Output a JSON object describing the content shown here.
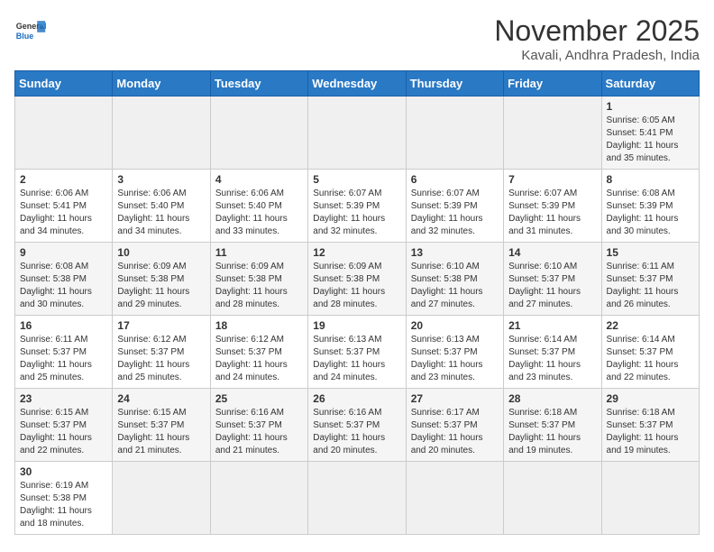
{
  "header": {
    "logo_general": "General",
    "logo_blue": "Blue",
    "month_year": "November 2025",
    "location": "Kavali, Andhra Pradesh, India"
  },
  "days_of_week": [
    "Sunday",
    "Monday",
    "Tuesday",
    "Wednesday",
    "Thursday",
    "Friday",
    "Saturday"
  ],
  "weeks": [
    [
      {
        "day": "",
        "info": ""
      },
      {
        "day": "",
        "info": ""
      },
      {
        "day": "",
        "info": ""
      },
      {
        "day": "",
        "info": ""
      },
      {
        "day": "",
        "info": ""
      },
      {
        "day": "",
        "info": ""
      },
      {
        "day": "1",
        "info": "Sunrise: 6:05 AM\nSunset: 5:41 PM\nDaylight: 11 hours\nand 35 minutes."
      }
    ],
    [
      {
        "day": "2",
        "info": "Sunrise: 6:06 AM\nSunset: 5:41 PM\nDaylight: 11 hours\nand 34 minutes."
      },
      {
        "day": "3",
        "info": "Sunrise: 6:06 AM\nSunset: 5:40 PM\nDaylight: 11 hours\nand 34 minutes."
      },
      {
        "day": "4",
        "info": "Sunrise: 6:06 AM\nSunset: 5:40 PM\nDaylight: 11 hours\nand 33 minutes."
      },
      {
        "day": "5",
        "info": "Sunrise: 6:07 AM\nSunset: 5:39 PM\nDaylight: 11 hours\nand 32 minutes."
      },
      {
        "day": "6",
        "info": "Sunrise: 6:07 AM\nSunset: 5:39 PM\nDaylight: 11 hours\nand 32 minutes."
      },
      {
        "day": "7",
        "info": "Sunrise: 6:07 AM\nSunset: 5:39 PM\nDaylight: 11 hours\nand 31 minutes."
      },
      {
        "day": "8",
        "info": "Sunrise: 6:08 AM\nSunset: 5:39 PM\nDaylight: 11 hours\nand 30 minutes."
      }
    ],
    [
      {
        "day": "9",
        "info": "Sunrise: 6:08 AM\nSunset: 5:38 PM\nDaylight: 11 hours\nand 30 minutes."
      },
      {
        "day": "10",
        "info": "Sunrise: 6:09 AM\nSunset: 5:38 PM\nDaylight: 11 hours\nand 29 minutes."
      },
      {
        "day": "11",
        "info": "Sunrise: 6:09 AM\nSunset: 5:38 PM\nDaylight: 11 hours\nand 28 minutes."
      },
      {
        "day": "12",
        "info": "Sunrise: 6:09 AM\nSunset: 5:38 PM\nDaylight: 11 hours\nand 28 minutes."
      },
      {
        "day": "13",
        "info": "Sunrise: 6:10 AM\nSunset: 5:38 PM\nDaylight: 11 hours\nand 27 minutes."
      },
      {
        "day": "14",
        "info": "Sunrise: 6:10 AM\nSunset: 5:37 PM\nDaylight: 11 hours\nand 27 minutes."
      },
      {
        "day": "15",
        "info": "Sunrise: 6:11 AM\nSunset: 5:37 PM\nDaylight: 11 hours\nand 26 minutes."
      }
    ],
    [
      {
        "day": "16",
        "info": "Sunrise: 6:11 AM\nSunset: 5:37 PM\nDaylight: 11 hours\nand 25 minutes."
      },
      {
        "day": "17",
        "info": "Sunrise: 6:12 AM\nSunset: 5:37 PM\nDaylight: 11 hours\nand 25 minutes."
      },
      {
        "day": "18",
        "info": "Sunrise: 6:12 AM\nSunset: 5:37 PM\nDaylight: 11 hours\nand 24 minutes."
      },
      {
        "day": "19",
        "info": "Sunrise: 6:13 AM\nSunset: 5:37 PM\nDaylight: 11 hours\nand 24 minutes."
      },
      {
        "day": "20",
        "info": "Sunrise: 6:13 AM\nSunset: 5:37 PM\nDaylight: 11 hours\nand 23 minutes."
      },
      {
        "day": "21",
        "info": "Sunrise: 6:14 AM\nSunset: 5:37 PM\nDaylight: 11 hours\nand 23 minutes."
      },
      {
        "day": "22",
        "info": "Sunrise: 6:14 AM\nSunset: 5:37 PM\nDaylight: 11 hours\nand 22 minutes."
      }
    ],
    [
      {
        "day": "23",
        "info": "Sunrise: 6:15 AM\nSunset: 5:37 PM\nDaylight: 11 hours\nand 22 minutes."
      },
      {
        "day": "24",
        "info": "Sunrise: 6:15 AM\nSunset: 5:37 PM\nDaylight: 11 hours\nand 21 minutes."
      },
      {
        "day": "25",
        "info": "Sunrise: 6:16 AM\nSunset: 5:37 PM\nDaylight: 11 hours\nand 21 minutes."
      },
      {
        "day": "26",
        "info": "Sunrise: 6:16 AM\nSunset: 5:37 PM\nDaylight: 11 hours\nand 20 minutes."
      },
      {
        "day": "27",
        "info": "Sunrise: 6:17 AM\nSunset: 5:37 PM\nDaylight: 11 hours\nand 20 minutes."
      },
      {
        "day": "28",
        "info": "Sunrise: 6:18 AM\nSunset: 5:37 PM\nDaylight: 11 hours\nand 19 minutes."
      },
      {
        "day": "29",
        "info": "Sunrise: 6:18 AM\nSunset: 5:37 PM\nDaylight: 11 hours\nand 19 minutes."
      }
    ],
    [
      {
        "day": "30",
        "info": "Sunrise: 6:19 AM\nSunset: 5:38 PM\nDaylight: 11 hours\nand 18 minutes."
      },
      {
        "day": "",
        "info": ""
      },
      {
        "day": "",
        "info": ""
      },
      {
        "day": "",
        "info": ""
      },
      {
        "day": "",
        "info": ""
      },
      {
        "day": "",
        "info": ""
      },
      {
        "day": "",
        "info": ""
      }
    ]
  ]
}
